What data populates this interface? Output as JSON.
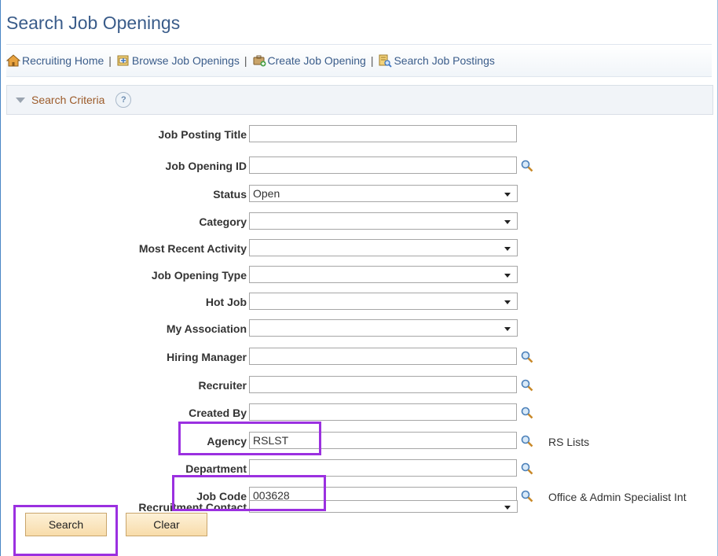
{
  "page": {
    "title": "Search Job Openings"
  },
  "links": [
    {
      "label": "Recruiting Home",
      "icon": "home-icon"
    },
    {
      "label": "Browse Job Openings",
      "icon": "browse-icon"
    },
    {
      "label": "Create Job Opening",
      "icon": "create-icon"
    },
    {
      "label": "Search Job Postings",
      "icon": "search-postings-icon"
    }
  ],
  "link_separator": "|",
  "criteria": {
    "title": "Search Criteria",
    "help": "?"
  },
  "fields": {
    "job_posting_title": {
      "label": "Job Posting Title",
      "value": ""
    },
    "job_opening_id": {
      "label": "Job Opening ID",
      "value": ""
    },
    "status": {
      "label": "Status",
      "value": "Open"
    },
    "category": {
      "label": "Category",
      "value": ""
    },
    "most_recent_activity": {
      "label": "Most Recent Activity",
      "value": ""
    },
    "job_opening_type": {
      "label": "Job Opening Type",
      "value": ""
    },
    "hot_job": {
      "label": "Hot Job",
      "value": ""
    },
    "my_association": {
      "label": "My Association",
      "value": ""
    },
    "hiring_manager": {
      "label": "Hiring Manager",
      "value": ""
    },
    "recruiter": {
      "label": "Recruiter",
      "value": ""
    },
    "created_by": {
      "label": "Created By",
      "value": ""
    },
    "agency": {
      "label": "Agency",
      "value": "RSLST",
      "description": "RS Lists"
    },
    "department": {
      "label": "Department",
      "value": ""
    },
    "job_code": {
      "label": "Job Code",
      "value": "003628",
      "description": "Office & Admin Specialist Int"
    },
    "recruitment_contact": {
      "label": "Recruitment Contact",
      "value": ""
    }
  },
  "buttons": {
    "search": "Search",
    "clear": "Clear"
  },
  "colors": {
    "highlight": "#9b30e0",
    "title": "#3a5c8a",
    "button_bg": "#f8dcaa"
  }
}
